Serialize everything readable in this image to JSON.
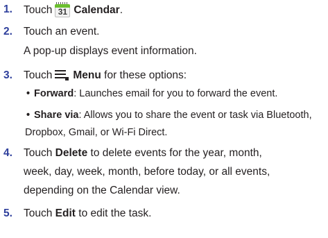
{
  "steps": [
    {
      "number": "1.",
      "pre": "Touch",
      "icon_name": "calendar-icon",
      "icon_text": "31",
      "bold": "Calendar",
      "post": "."
    },
    {
      "number": "2.",
      "line1": "Touch an event.",
      "line2": "A pop-up displays event information."
    },
    {
      "number": "3.",
      "pre": "Touch",
      "icon_name": "menu-icon",
      "bold": "Menu",
      "post": " for these options:",
      "bullets": [
        {
          "bullet": "•",
          "term": "Forward",
          "text": ": Launches email for you to forward the event."
        },
        {
          "bullet": "•",
          "term": "Share via",
          "text": ": Allows you to share the event or task via Bluetooth,",
          "text_cont": "Dropbox, Gmail, or Wi-Fi Direct."
        }
      ]
    },
    {
      "number": "4.",
      "pre": "Touch ",
      "bold": "Delete",
      "post": " to delete events for the year, month,",
      "line2": "week, day, week, month, before today, or all events,",
      "line3": "depending on the Calendar view."
    },
    {
      "number": "5.",
      "pre": "Touch ",
      "bold": "Edit",
      "post": " to edit the task."
    }
  ],
  "colors": {
    "step_number": "#2e3f9c",
    "text": "#231f20",
    "calendar_icon_header": "#6bbf2f"
  }
}
